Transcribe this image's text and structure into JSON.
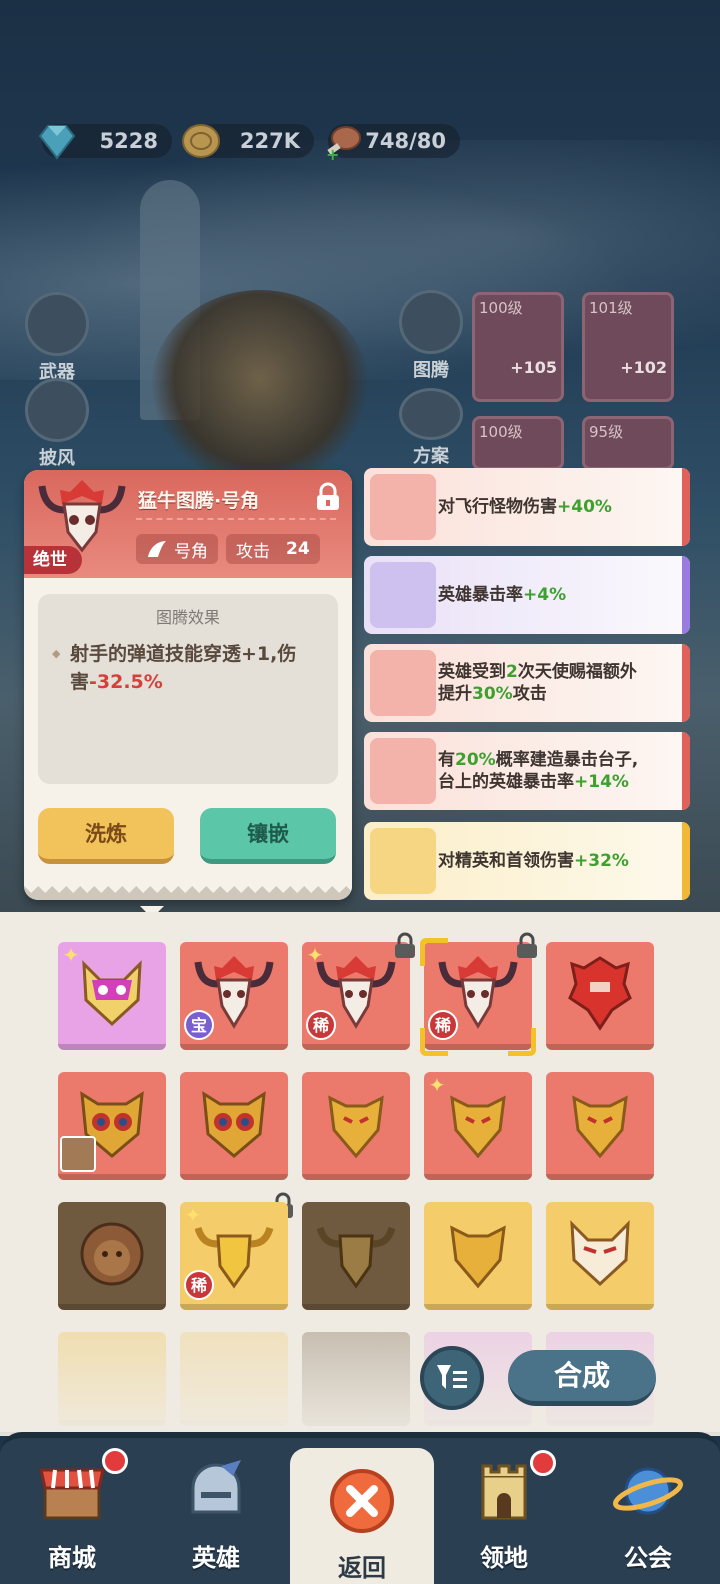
{
  "resources": {
    "gems": "5228",
    "coins": "227K",
    "stamina": "748/80"
  },
  "left_menu": {
    "weapon": "武器",
    "cloak": "披风"
  },
  "right_menu": {
    "totem": "图腾",
    "plan": "方案"
  },
  "equip_slots": [
    {
      "level": "100级",
      "plus": "+105"
    },
    {
      "level": "101级",
      "plus": "+102"
    },
    {
      "level": "100级",
      "plus": ""
    },
    {
      "level": "95级",
      "plus": ""
    }
  ],
  "detail": {
    "title": "猛牛图腾·号角",
    "grade": "绝世",
    "tag_type": "号角",
    "stat_label": "攻击",
    "stat_value": "24",
    "effect_header": "图腾效果",
    "effect_text_main": "射手的弹道技能穿透+1,伤害",
    "effect_text_value": "-32.5%",
    "refine_button": "洗炼",
    "inlay_button": "镶嵌"
  },
  "effects": [
    {
      "pre": "对飞行怪物伤害",
      "val": "+40%",
      "post": "",
      "color": "red"
    },
    {
      "pre": "英雄暴击率",
      "val": "+4%",
      "post": "",
      "color": "purple"
    },
    {
      "line1_a": "英雄受到",
      "line1_b": "2",
      "line1_c": "次天使赐福额外",
      "line2_a": "提升",
      "line2_b": "30%",
      "line2_c": "攻击",
      "color": "red"
    },
    {
      "line1_a": "有",
      "line1_b": "20%",
      "line1_c": "概率建造暴击台子,",
      "line2_a": "台上的英雄暴击率",
      "line2_b": "+14%",
      "line2_c": "",
      "color": "red"
    },
    {
      "pre": "对精英和首领伤害",
      "val": "+32%",
      "post": "",
      "color": "gold"
    }
  ],
  "inventory": {
    "badge_treasure": "宝",
    "badge_rare": "稀",
    "merge_button": "合成",
    "filter_icon": "filter-icon"
  },
  "nav": {
    "shop": "商城",
    "hero": "英雄",
    "back": "返回",
    "territory": "领地",
    "guild": "公会"
  },
  "colors": {
    "red_tile": "#ec7a6c",
    "gold_tile": "#f4cd6a",
    "pink_tile": "#e8a3e6",
    "brown_tile": "#6f5a40",
    "accent_green": "#3da02f",
    "negative_red": "#d5413a"
  }
}
